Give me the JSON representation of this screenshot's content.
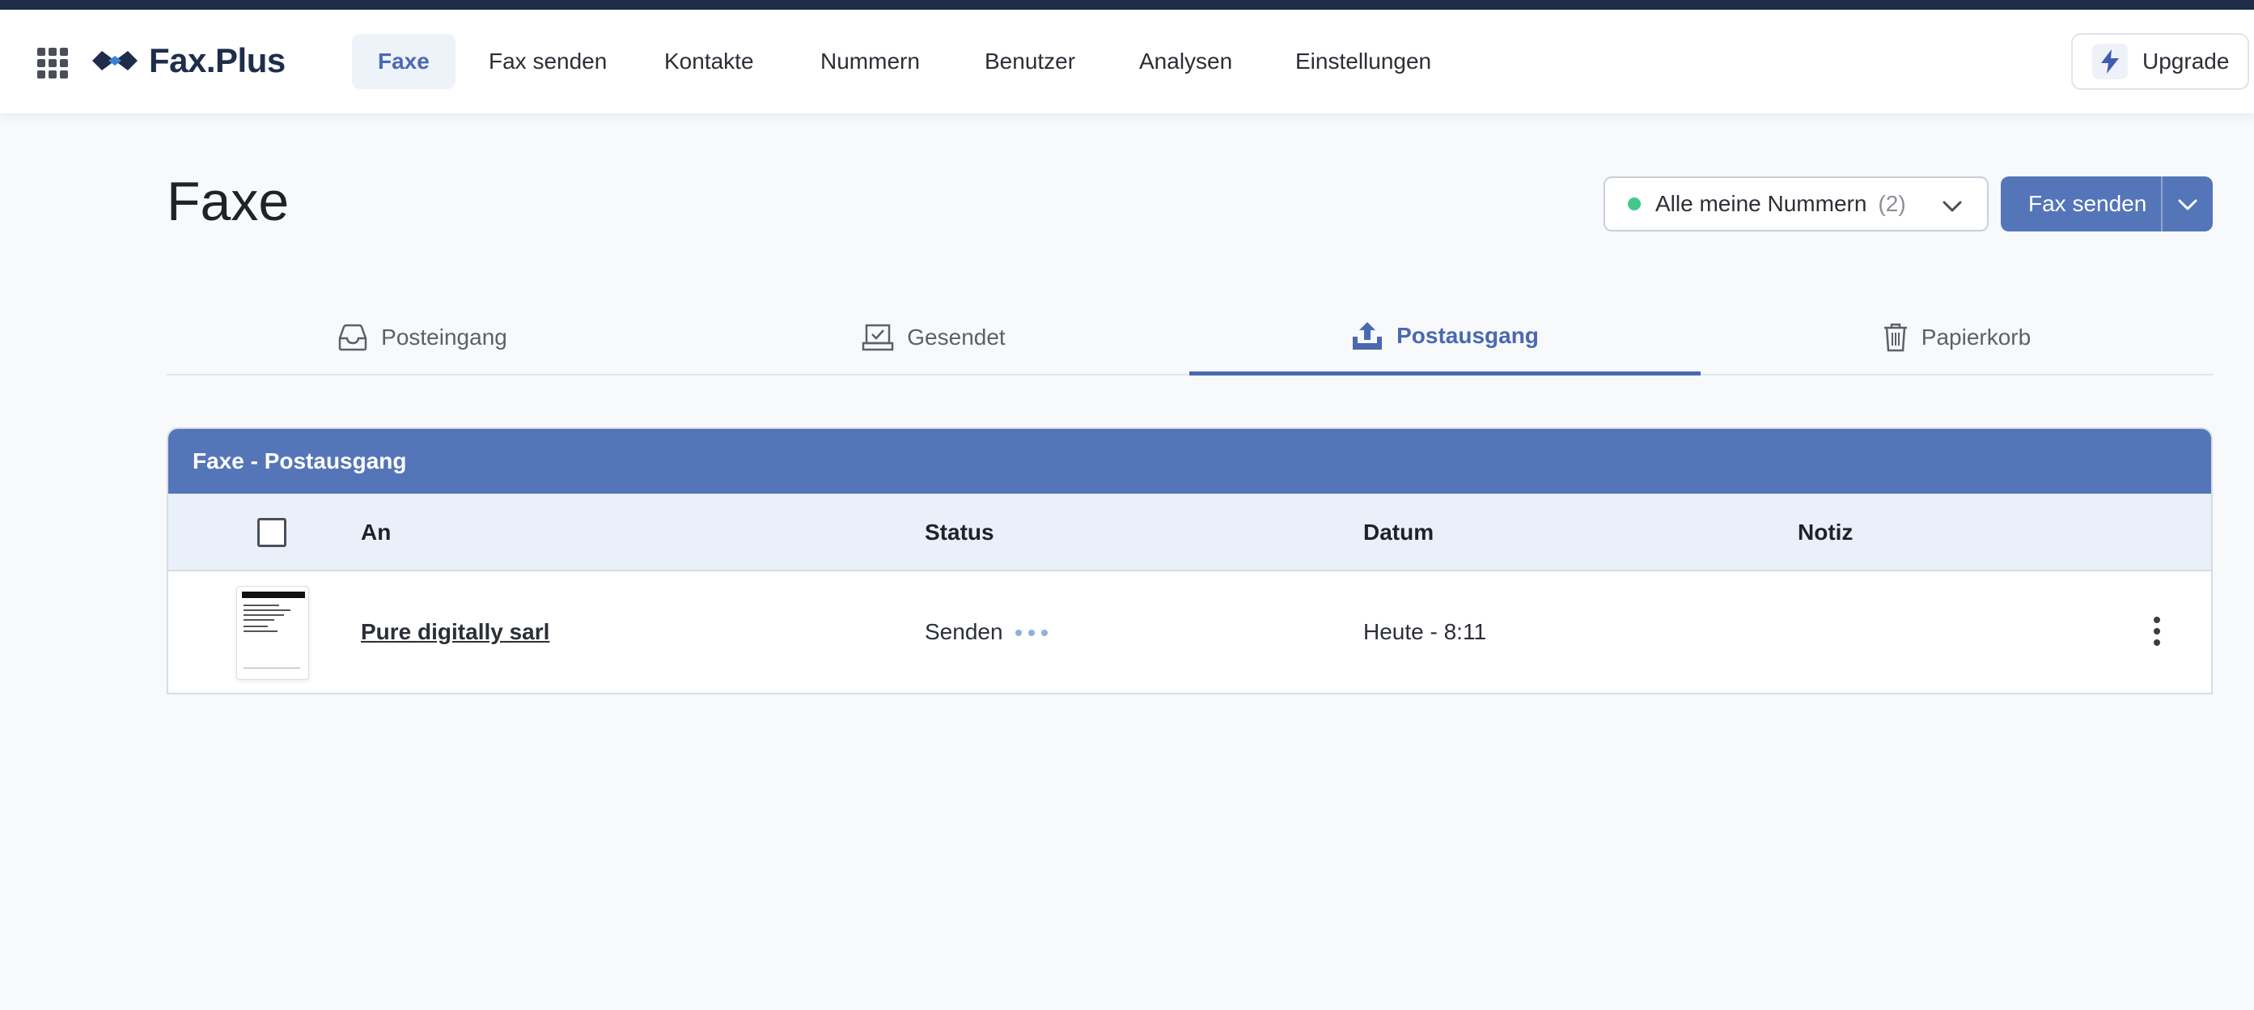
{
  "app": {
    "logo_text": "Fax.Plus"
  },
  "nav": {
    "items": [
      {
        "label": "Faxe",
        "active": true
      },
      {
        "label": "Fax senden"
      },
      {
        "label": "Kontakte"
      },
      {
        "label": "Nummern"
      },
      {
        "label": "Benutzer"
      },
      {
        "label": "Analysen"
      },
      {
        "label": "Einstellungen"
      }
    ],
    "upgrade_label": "Upgrade"
  },
  "page": {
    "title": "Faxe",
    "numbers_filter": {
      "label": "Alle meine Nummern",
      "count": "(2)"
    },
    "send_button_label": "Fax senden"
  },
  "tabs": [
    {
      "label": "Posteingang",
      "icon": "inbox-icon"
    },
    {
      "label": "Gesendet",
      "icon": "sent-icon"
    },
    {
      "label": "Postausgang",
      "icon": "outbox-upload-icon",
      "active": true
    },
    {
      "label": "Papierkorb",
      "icon": "trash-icon"
    }
  ],
  "table": {
    "title": "Faxe - Postausgang",
    "columns": {
      "to": "An",
      "status": "Status",
      "date": "Datum",
      "note": "Notiz"
    },
    "rows": [
      {
        "recipient": "Pure digitally sarl",
        "status": "Senden",
        "date": "Heute - 8:11",
        "note": ""
      }
    ]
  },
  "colors": {
    "accent": "#5575b9",
    "nav_dark": "#1e2d4a",
    "status_dot": "#43c78a"
  }
}
